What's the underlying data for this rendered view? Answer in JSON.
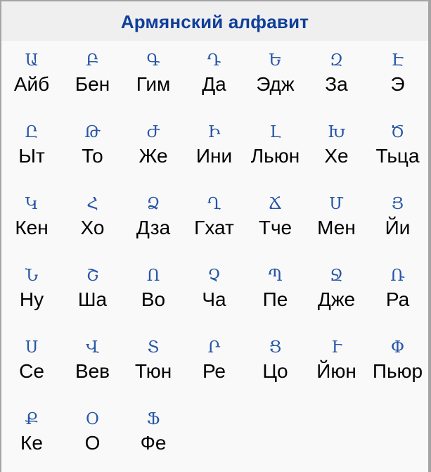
{
  "title": "Армянский алфавит",
  "colors": {
    "title": "#0f3f9a",
    "letter": "#2656a5",
    "name": "#000000",
    "header_bg": "#efefef",
    "body_bg": "#f9f9f9",
    "border": "#a4a4a4"
  },
  "letters": [
    {
      "glyph": "Ա",
      "name": "Айб"
    },
    {
      "glyph": "Բ",
      "name": "Бен"
    },
    {
      "glyph": "Գ",
      "name": "Гим"
    },
    {
      "glyph": "Դ",
      "name": "Да"
    },
    {
      "glyph": "Ե",
      "name": "Эдж"
    },
    {
      "glyph": "Զ",
      "name": "За"
    },
    {
      "glyph": "Է",
      "name": "Э"
    },
    {
      "glyph": "Ը",
      "name": "Ыт"
    },
    {
      "glyph": "Թ",
      "name": "То"
    },
    {
      "glyph": "Ժ",
      "name": "Же"
    },
    {
      "glyph": "Ի",
      "name": "Ини"
    },
    {
      "glyph": "Լ",
      "name": "Льюн"
    },
    {
      "glyph": "Խ",
      "name": "Хе"
    },
    {
      "glyph": "Ծ",
      "name": "Тьца"
    },
    {
      "glyph": "Կ",
      "name": "Кен"
    },
    {
      "glyph": "Հ",
      "name": "Хо"
    },
    {
      "glyph": "Ձ",
      "name": "Дза"
    },
    {
      "glyph": "Ղ",
      "name": "Гхат"
    },
    {
      "glyph": "Ճ",
      "name": "Тче"
    },
    {
      "glyph": "Մ",
      "name": "Мен"
    },
    {
      "glyph": "Յ",
      "name": "Йи"
    },
    {
      "glyph": "Ն",
      "name": "Ну"
    },
    {
      "glyph": "Շ",
      "name": "Ша"
    },
    {
      "glyph": "Ո",
      "name": "Во"
    },
    {
      "glyph": "Չ",
      "name": "Ча"
    },
    {
      "glyph": "Պ",
      "name": "Пе"
    },
    {
      "glyph": "Ջ",
      "name": "Дже"
    },
    {
      "glyph": "Ռ",
      "name": "Ра"
    },
    {
      "glyph": "Ս",
      "name": "Се"
    },
    {
      "glyph": "Վ",
      "name": "Вев"
    },
    {
      "glyph": "Տ",
      "name": "Тюн"
    },
    {
      "glyph": "Ր",
      "name": "Ре"
    },
    {
      "glyph": "Ց",
      "name": "Цо"
    },
    {
      "glyph": "Ւ",
      "name": "Йюн"
    },
    {
      "glyph": "Փ",
      "name": "Пьюр"
    },
    {
      "glyph": "Ք",
      "name": "Ке"
    },
    {
      "glyph": "Օ",
      "name": "О"
    },
    {
      "glyph": "Ֆ",
      "name": "Фе"
    }
  ]
}
